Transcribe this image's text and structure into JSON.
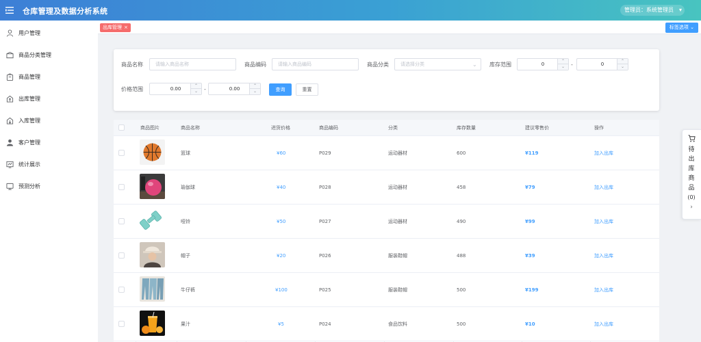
{
  "app": {
    "title": "仓库管理及数据分析系统",
    "user_label": "管理员：系统管理员"
  },
  "sidebar": {
    "items": [
      {
        "label": "用户管理",
        "icon": "user-icon"
      },
      {
        "label": "商品分类管理",
        "icon": "category-icon"
      },
      {
        "label": "商品管理",
        "icon": "product-icon"
      },
      {
        "label": "出库管理",
        "icon": "outbound-icon"
      },
      {
        "label": "入库管理",
        "icon": "inbound-icon"
      },
      {
        "label": "客户管理",
        "icon": "customer-icon"
      },
      {
        "label": "统计展示",
        "icon": "stats-icon"
      },
      {
        "label": "预测分析",
        "icon": "forecast-icon"
      }
    ]
  },
  "tags": {
    "active_tag": "出库管理",
    "close_symbol": "×",
    "options_label": "标签选项"
  },
  "search": {
    "name_label": "商品名称",
    "name_placeholder": "请输入商品名称",
    "code_label": "商品编码",
    "code_placeholder": "请输入商品编码",
    "category_label": "商品分类",
    "category_placeholder": "请选择分类",
    "stock_label": "库存范围",
    "stock_min": "0",
    "stock_max": "0",
    "price_label": "价格范围",
    "price_min": "0.00",
    "price_max": "0.00",
    "range_separator": "-",
    "query_button": "查询",
    "reset_button": "重置"
  },
  "table": {
    "headers": [
      "商品图片",
      "商品名称",
      "进货价格",
      "商品编码",
      "分类",
      "库存数量",
      "建议零售价",
      "操作"
    ],
    "rows": [
      {
        "name": "篮球",
        "purchase_price": "¥60",
        "code": "P029",
        "category": "运动器材",
        "stock": "600",
        "retail_price": "¥119",
        "action": "加入出库",
        "image": "basketball"
      },
      {
        "name": "瑜伽球",
        "purchase_price": "¥40",
        "code": "P028",
        "category": "运动器材",
        "stock": "458",
        "retail_price": "¥79",
        "action": "加入出库",
        "image": "yoga-ball"
      },
      {
        "name": "哑铃",
        "purchase_price": "¥50",
        "code": "P027",
        "category": "运动器材",
        "stock": "490",
        "retail_price": "¥99",
        "action": "加入出库",
        "image": "dumbbell"
      },
      {
        "name": "帽子",
        "purchase_price": "¥20",
        "code": "P026",
        "category": "服装鞋帽",
        "stock": "488",
        "retail_price": "¥39",
        "action": "加入出库",
        "image": "hat"
      },
      {
        "name": "牛仔裤",
        "purchase_price": "¥100",
        "code": "P025",
        "category": "服装鞋帽",
        "stock": "500",
        "retail_price": "¥199",
        "action": "加入出库",
        "image": "jeans"
      },
      {
        "name": "果汁",
        "purchase_price": "¥5",
        "code": "P024",
        "category": "食品饮料",
        "stock": "500",
        "retail_price": "¥10",
        "action": "加入出库",
        "image": "juice"
      }
    ]
  },
  "cart": {
    "label": "待出库商品",
    "count": "(0)",
    "arrow": "›"
  },
  "colors": {
    "primary": "#409eff",
    "tag_red": "#f56c6c",
    "header_start": "#3d7fd6",
    "header_end": "#48c4c0"
  }
}
